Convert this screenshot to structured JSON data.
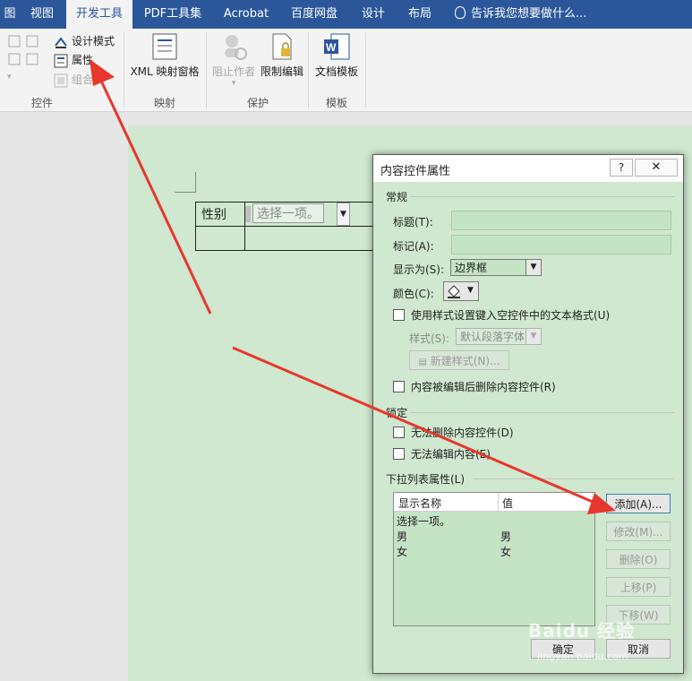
{
  "ribbon": {
    "tabs": [
      "图",
      "视图",
      "开发工具",
      "PDF工具集",
      "Acrobat",
      "百度网盘",
      "设计",
      "布局"
    ],
    "active_tab": "开发工具",
    "tell_me": "告诉我您想要做什么...",
    "controls_group": {
      "label": "控件",
      "design_mode": "设计模式",
      "properties": "属性",
      "group": "组合"
    },
    "mapping_group": {
      "label": "映射",
      "xml_pane": "XML 映射窗格"
    },
    "protect_group": {
      "label": "保护",
      "block_authors": "阻止作者",
      "restrict_editing": "限制编辑"
    },
    "templates_group": {
      "label": "模板",
      "doc_template": "文档模板"
    }
  },
  "document": {
    "table": {
      "cell_label": "性别",
      "content_control_placeholder": "选择一项。"
    }
  },
  "dialog": {
    "title": "内容控件属性",
    "help": "?",
    "close": "✕",
    "general_section": "常规",
    "title_label": "标题(T):",
    "tag_label": "标记(A):",
    "show_as_label": "显示为(S):",
    "show_as_value": "边界框",
    "color_label": "颜色(C):",
    "use_style_checkbox": "使用样式设置键入空控件中的文本格式(U)",
    "style_label": "样式(S):",
    "style_value": "默认段落字体",
    "new_style_button": "新建样式(N)...",
    "remove_when_edited": "内容被编辑后删除内容控件(R)",
    "locking_section": "锁定",
    "cannot_delete": "无法删除内容控件(D)",
    "cannot_edit": "无法编辑内容(E)",
    "dropdown_section": "下拉列表属性(L)",
    "list_headers": {
      "display_name": "显示名称",
      "value": "值"
    },
    "list_items": [
      {
        "display": "选择一项。",
        "value": ""
      },
      {
        "display": "男",
        "value": "男"
      },
      {
        "display": "女",
        "value": "女"
      }
    ],
    "buttons": {
      "add": "添加(A)...",
      "modify": "修改(M)...",
      "remove": "删除(O)",
      "move_up": "上移(P)",
      "move_down": "下移(W)",
      "ok": "确定",
      "cancel": "取消"
    }
  },
  "watermark": {
    "brand": "Baidu 经验",
    "url": "jingyan.baidu.com"
  },
  "colors": {
    "accent": "#2b579a",
    "page_bg": "#cfe8cf",
    "arrow": "#e8372c"
  }
}
